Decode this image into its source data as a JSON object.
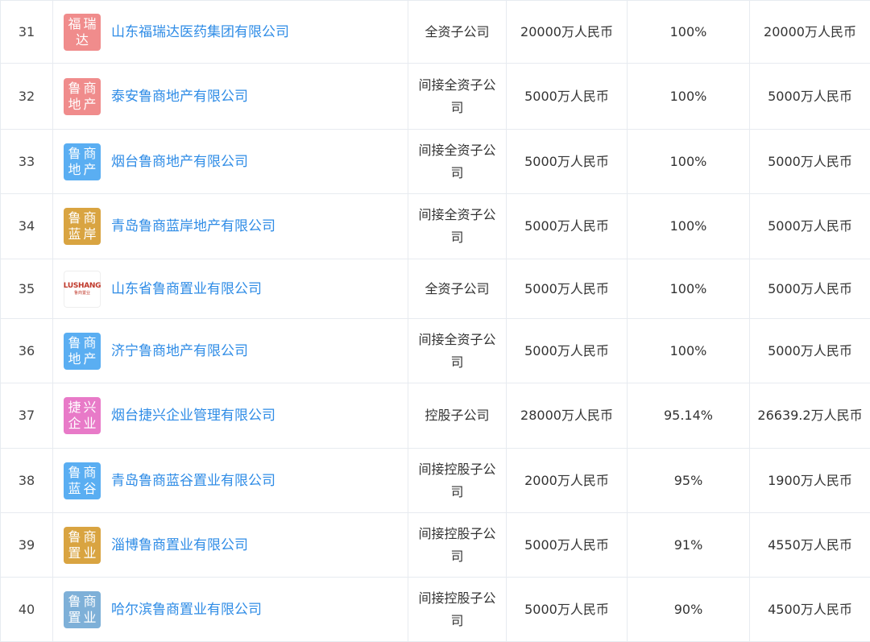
{
  "rows": [
    {
      "index": "31",
      "logo": {
        "chars": [
          "福",
          "瑞",
          "达"
        ],
        "color": "#f08c8c"
      },
      "name": "山东福瑞达医药集团有限公司",
      "type": "全资子公司",
      "capital": "20000万人民币",
      "ratio": "100%",
      "amount": "20000万人民币"
    },
    {
      "index": "32",
      "logo": {
        "chars": [
          "鲁",
          "商",
          "地",
          "产"
        ],
        "color": "#f08c8c"
      },
      "name": "泰安鲁商地产有限公司",
      "type": "间接全资子公司",
      "capital": "5000万人民币",
      "ratio": "100%",
      "amount": "5000万人民币"
    },
    {
      "index": "33",
      "logo": {
        "chars": [
          "鲁",
          "商",
          "地",
          "产"
        ],
        "color": "#5aaef2"
      },
      "name": "烟台鲁商地产有限公司",
      "type": "间接全资子公司",
      "capital": "5000万人民币",
      "ratio": "100%",
      "amount": "5000万人民币"
    },
    {
      "index": "34",
      "logo": {
        "chars": [
          "鲁",
          "商",
          "蓝",
          "岸"
        ],
        "color": "#d9a441"
      },
      "name": "青岛鲁商蓝岸地产有限公司",
      "type": "间接全资子公司",
      "capital": "5000万人民币",
      "ratio": "100%",
      "amount": "5000万人民币"
    },
    {
      "index": "35",
      "logo": {
        "image": true,
        "brand": "LUSHANG",
        "brand_sub": "鲁商置业"
      },
      "name": "山东省鲁商置业有限公司",
      "type": "全资子公司",
      "capital": "5000万人民币",
      "ratio": "100%",
      "amount": "5000万人民币"
    },
    {
      "index": "36",
      "logo": {
        "chars": [
          "鲁",
          "商",
          "地",
          "产"
        ],
        "color": "#5aaef2"
      },
      "name": "济宁鲁商地产有限公司",
      "type": "间接全资子公司",
      "capital": "5000万人民币",
      "ratio": "100%",
      "amount": "5000万人民币"
    },
    {
      "index": "37",
      "logo": {
        "chars": [
          "捷",
          "兴",
          "企",
          "业"
        ],
        "color": "#e87ac8"
      },
      "name": "烟台捷兴企业管理有限公司",
      "type": "控股子公司",
      "capital": "28000万人民币",
      "ratio": "95.14%",
      "amount": "26639.2万人民币"
    },
    {
      "index": "38",
      "logo": {
        "chars": [
          "鲁",
          "商",
          "蓝",
          "谷"
        ],
        "color": "#5aaef2"
      },
      "name": "青岛鲁商蓝谷置业有限公司",
      "type": "间接控股子公司",
      "capital": "2000万人民币",
      "ratio": "95%",
      "amount": "1900万人民币"
    },
    {
      "index": "39",
      "logo": {
        "chars": [
          "鲁",
          "商",
          "置",
          "业"
        ],
        "color": "#d9a441"
      },
      "name": "淄博鲁商置业有限公司",
      "type": "间接控股子公司",
      "capital": "5000万人民币",
      "ratio": "91%",
      "amount": "4550万人民币"
    },
    {
      "index": "40",
      "logo": {
        "chars": [
          "鲁",
          "商",
          "置",
          "业"
        ],
        "color": "#7eb0d8"
      },
      "name": "哈尔滨鲁商置业有限公司",
      "type": "间接控股子公司",
      "capital": "5000万人民币",
      "ratio": "90%",
      "amount": "4500万人民币"
    }
  ]
}
